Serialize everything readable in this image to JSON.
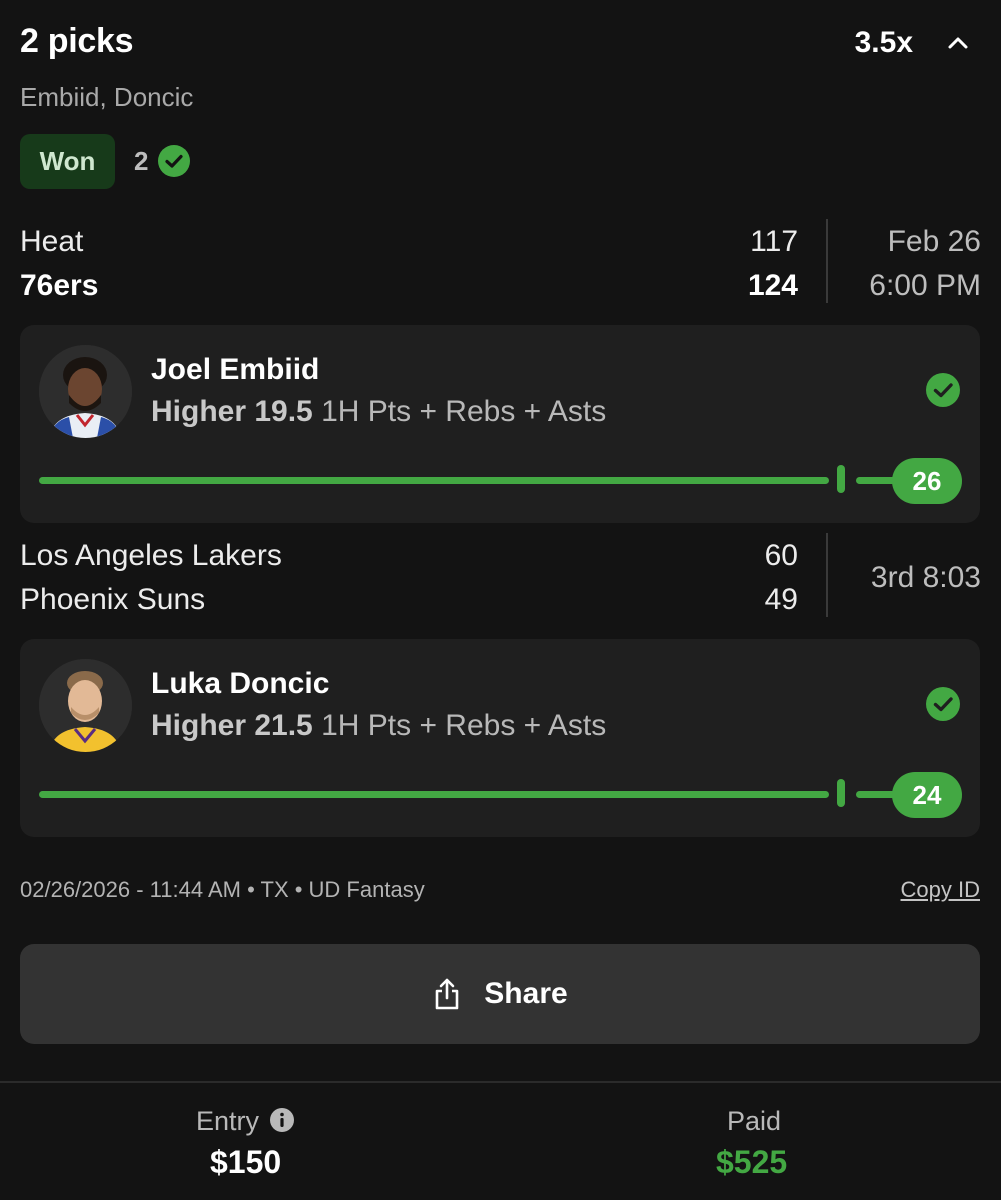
{
  "header": {
    "title": "2 picks",
    "multiplier": "3.5x",
    "players_summary": "Embiid, Doncic",
    "status_badge": "Won",
    "correct_count": "2"
  },
  "games": [
    {
      "team_1": "Heat",
      "score_1": "117",
      "team_2": "76ers",
      "score_2": "124",
      "date": "Feb 26",
      "time": "6:00 PM"
    },
    {
      "team_1": "Los Angeles Lakers",
      "score_1": "60",
      "team_2": "Phoenix Suns",
      "score_2": "49",
      "status": "3rd 8:03"
    }
  ],
  "picks": [
    {
      "player": "Joel Embiid",
      "direction_line": "Higher 19.5",
      "stat": "1H Pts + Rebs + Asts",
      "result": "26",
      "avatar_icon": "player-photo-embiid"
    },
    {
      "player": "Luka Doncic",
      "direction_line": "Higher 21.5",
      "stat": "1H Pts + Rebs + Asts",
      "result": "24",
      "avatar_icon": "player-photo-doncic"
    }
  ],
  "footer": {
    "meta": "02/26/2026 - 11:44 AM • TX • UD Fantasy",
    "copy_id": "Copy ID",
    "share_label": "Share",
    "entry_label": "Entry",
    "entry_value": "$150",
    "paid_label": "Paid",
    "paid_value": "$525"
  },
  "colors": {
    "background": "#131313",
    "card": "#1f1f1f",
    "accent_green": "#43a843",
    "won_badge_bg": "#173a1a",
    "button": "#333333"
  }
}
